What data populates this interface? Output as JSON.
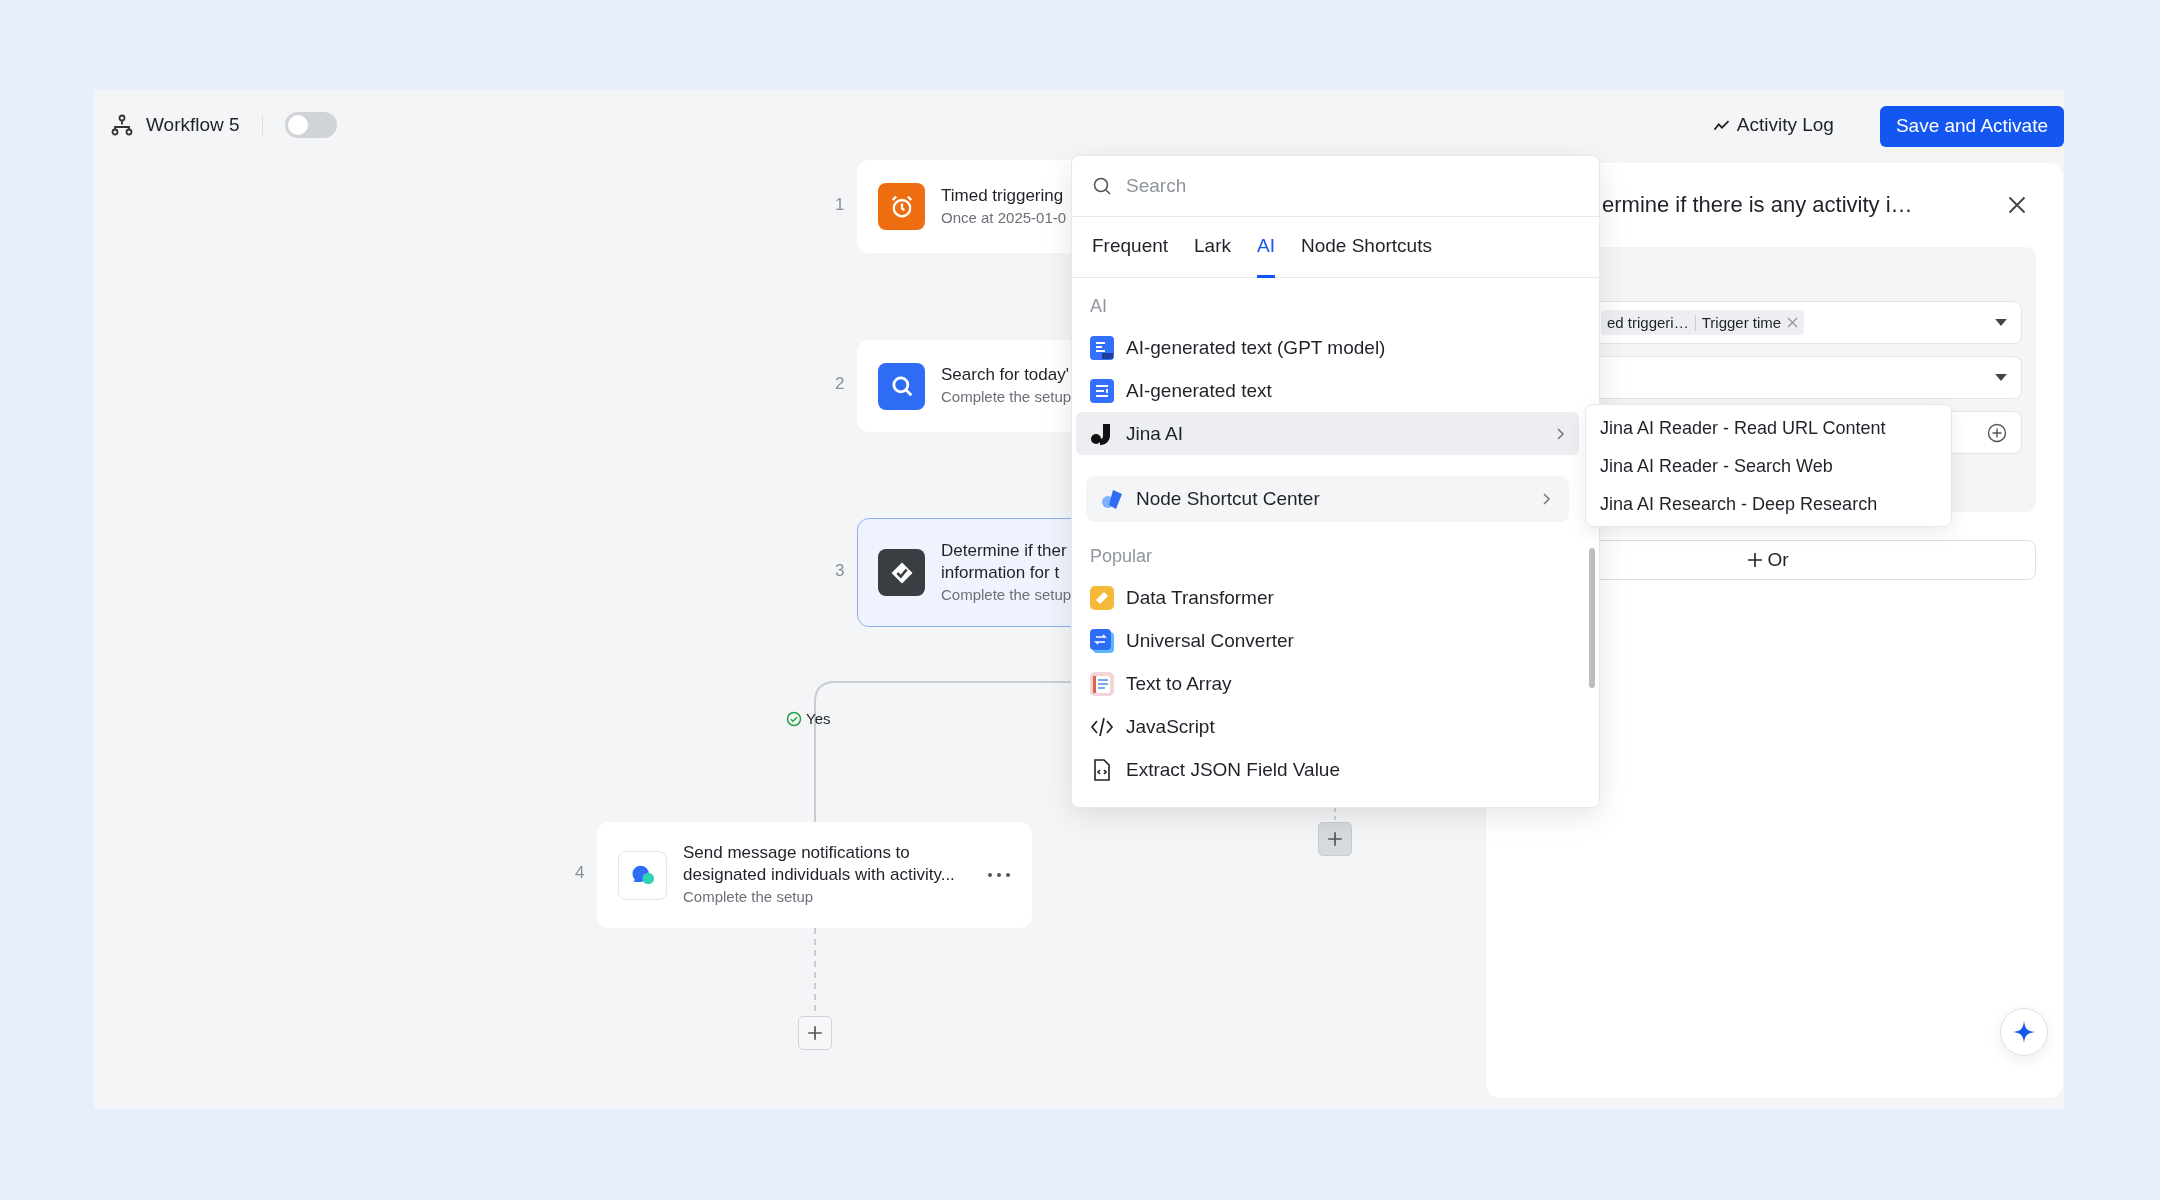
{
  "header": {
    "title": "Workflow 5",
    "enabled": false,
    "activity_log": "Activity Log",
    "save_button": "Save and Activate"
  },
  "nodes": [
    {
      "number": "1",
      "kind": "timer",
      "title": "Timed triggering",
      "subtitle": "Once at 2025-01-0",
      "selected": false
    },
    {
      "number": "2",
      "kind": "search",
      "title": "Search for today'",
      "subtitle": "Complete the setup",
      "selected": false
    },
    {
      "number": "3",
      "kind": "condition",
      "title": "Determine if ther",
      "title_2": "information for t",
      "subtitle": "Complete the setup",
      "selected": true
    },
    {
      "number": "4",
      "kind": "message",
      "title": "Send message notifications to",
      "title_2": "designated individuals with activity...",
      "subtitle": "Complete the setup",
      "selected": false
    }
  ],
  "branch": {
    "label": "Yes"
  },
  "node_menu": {
    "search_placeholder": "Search",
    "tabs": [
      {
        "label": "Frequent",
        "selected": false
      },
      {
        "label": "Lark",
        "selected": false
      },
      {
        "label": "AI",
        "selected": true
      },
      {
        "label": "Node Shortcuts",
        "selected": false
      }
    ],
    "ai_heading": "AI",
    "ai_items": [
      {
        "label": "AI-generated text (GPT model)",
        "submenu": false,
        "selected": false
      },
      {
        "label": "AI-generated text",
        "submenu": false,
        "selected": false
      },
      {
        "label": "Jina AI",
        "submenu": true,
        "selected": true
      }
    ],
    "shortcut_center": "Node Shortcut Center",
    "popular_heading": "Popular",
    "popular_items": [
      {
        "label": "Data Transformer",
        "selected": false
      },
      {
        "label": "Universal Converter",
        "selected": false
      },
      {
        "label": "Text to Array",
        "selected": false
      },
      {
        "label": "JavaScript",
        "selected": false
      },
      {
        "label": "Extract JSON Field Value",
        "selected": false
      }
    ]
  },
  "submenu": {
    "items": [
      "Jina AI Reader - Read URL Content",
      "Jina AI Reader - Search Web",
      "Jina AI Research - Deep Research"
    ]
  },
  "panel": {
    "title": "ermine if there is any activity i…",
    "tags": [
      "ed triggeri…",
      "Trigger time"
    ],
    "or_button": "Or"
  }
}
